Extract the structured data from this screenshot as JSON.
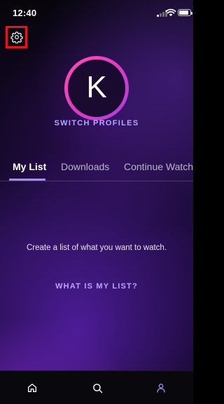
{
  "status_bar": {
    "time": "12:40"
  },
  "profile": {
    "initial": "K",
    "switch_label": "SWITCH PROFILES"
  },
  "tabs": [
    {
      "label": "My List",
      "active": true
    },
    {
      "label": "Downloads",
      "active": false
    },
    {
      "label": "Continue Watch",
      "active": false
    }
  ],
  "empty_state": {
    "message": "Create a list of what you want to watch.",
    "link": "WHAT IS MY LIST?"
  },
  "bottom_nav": {
    "items": [
      {
        "icon": "home-icon",
        "active": false
      },
      {
        "icon": "search-icon",
        "active": false
      },
      {
        "icon": "profile-icon",
        "active": true
      }
    ]
  },
  "colors": {
    "accent": "#b7a5ff",
    "avatar_ring": "#e13dbf",
    "highlight_box": "#e5141d"
  }
}
